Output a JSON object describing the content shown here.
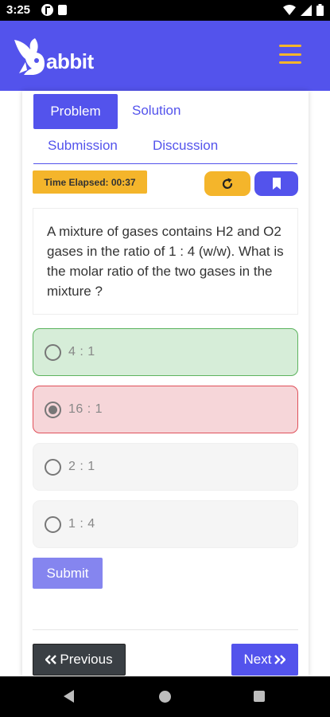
{
  "status_bar": {
    "time": "3:25",
    "icons": [
      "notification-icon",
      "lock-icon",
      "wifi-icon",
      "signal-icon",
      "battery-icon"
    ]
  },
  "header": {
    "logo_text": "abbit",
    "menu_icon": "hamburger-menu-icon"
  },
  "tabs": [
    {
      "label": "Problem",
      "active": true
    },
    {
      "label": "Solution",
      "active": false
    },
    {
      "label": "Submission",
      "active": false
    },
    {
      "label": "Discussion",
      "active": false
    }
  ],
  "timer": {
    "text": "Time Elapsed: 00:37"
  },
  "actions": {
    "reset_icon": "refresh-icon",
    "bookmark_icon": "bookmark-icon"
  },
  "question": {
    "text": "A mixture of gases contains H2 and O2 gases in the ratio of 1 : 4 (w/w). What is the molar ratio of the two gases in the mixture ?"
  },
  "options": [
    {
      "label": "4 : 1",
      "state": "correct",
      "selected": false
    },
    {
      "label": "16 : 1",
      "state": "wrong",
      "selected": true
    },
    {
      "label": "2 : 1",
      "state": "neutral",
      "selected": false
    },
    {
      "label": "1 : 4",
      "state": "neutral",
      "selected": false
    }
  ],
  "submit": {
    "label": "Submit"
  },
  "navigation": {
    "previous_label": "Previous",
    "next_label": "Next"
  },
  "colors": {
    "primary": "#5353ec",
    "accent": "#f4b52b",
    "correct_bg": "#d6edd8",
    "correct_border": "#5cb35e",
    "wrong_bg": "#f6d6d9",
    "wrong_border": "#e0505a",
    "dark_button": "#3a3f44"
  }
}
